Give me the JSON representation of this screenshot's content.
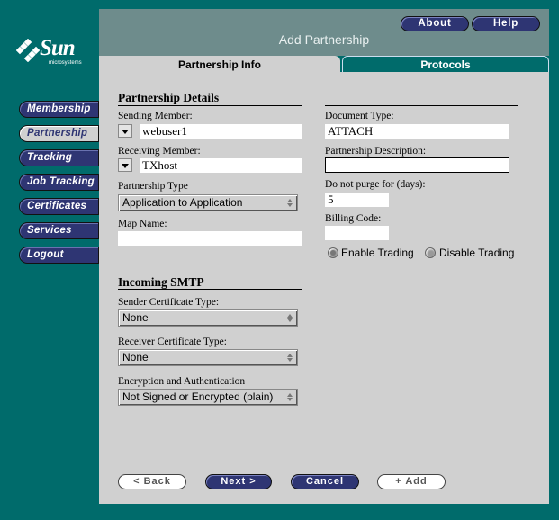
{
  "brand": {
    "word": "Sun",
    "tag": "microsystems"
  },
  "header": {
    "title": "Add Partnership",
    "about": "About",
    "help": "Help"
  },
  "tabs": {
    "info": "Partnership Info",
    "protocols": "Protocols"
  },
  "nav": [
    "Membership",
    "Partnership",
    "Tracking",
    "Job Tracking",
    "Certificates",
    "Services",
    "Logout"
  ],
  "details": {
    "heading": "Partnership Details",
    "sending_label": "Sending Member:",
    "sending_value": "webuser1",
    "receiving_label": "Receiving Member:",
    "receiving_value": "TXhost",
    "type_label": "Partnership Type",
    "type_value": "Application to Application",
    "map_label": "Map Name:",
    "map_value": ""
  },
  "right": {
    "doctype_label": "Document Type:",
    "doctype_value": "ATTACH",
    "desc_label": "Partnership Description:",
    "desc_value": "",
    "purge_label": "Do not purge for (days):",
    "purge_value": "5",
    "billing_label": "Billing Code:",
    "billing_value": "",
    "enable_label": "Enable Trading",
    "disable_label": "Disable Trading"
  },
  "smtp": {
    "heading": "Incoming SMTP",
    "sender_label": "Sender Certificate Type:",
    "sender_value": "None",
    "receiver_label": "Receiver Certificate Type:",
    "receiver_value": "None",
    "enc_label": "Encryption and Authentication",
    "enc_value": "Not Signed or Encrypted (plain)"
  },
  "buttons": {
    "back": "< Back",
    "next": "Next >",
    "cancel": "Cancel",
    "add": "+ Add"
  }
}
